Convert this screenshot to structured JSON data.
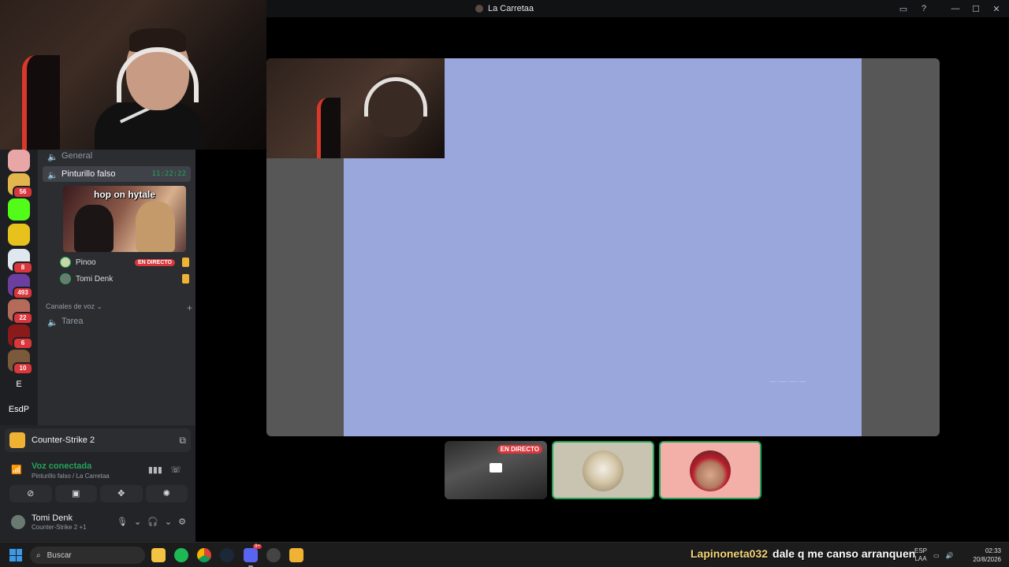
{
  "window": {
    "title": "La Carretaa"
  },
  "servers": [
    {
      "color": "#e8a6a6"
    },
    {
      "color": "#e2b64c",
      "badge": "56"
    },
    {
      "color": "#53fc18"
    },
    {
      "color": "#e8c21c"
    },
    {
      "color": "#dfe7ef",
      "badge": "8"
    },
    {
      "color": "#6b3fa0",
      "badge": "493"
    },
    {
      "color": "#b56b5a",
      "badge": "22"
    },
    {
      "color": "#8b1a1a",
      "badge": "6"
    },
    {
      "color": "#7a5a3a",
      "badge": "10"
    }
  ],
  "server_text": [
    "E",
    "EsdP"
  ],
  "channels": {
    "general": "General",
    "active": {
      "name": "Pinturillo falso",
      "time": "11:22:22"
    },
    "stream_preview_text": "hop on hytale",
    "members": [
      {
        "name": "Pinoo",
        "live": "EN DIRECTO"
      },
      {
        "name": "Tomi Denk"
      }
    ],
    "voice_section": "Canales de voz",
    "tarea": "Tarea"
  },
  "activity": {
    "game": "Counter-Strike 2"
  },
  "voice": {
    "status": "Voz conectada",
    "location": "Pinturillo falso / La Carretaa"
  },
  "user": {
    "name": "Tomi Denk",
    "game": "Counter-Strike 2 +1"
  },
  "stage": {
    "watermark": "—·—·—·—"
  },
  "tiles": {
    "live": "EN DIRECTO"
  },
  "taskbar": {
    "search": "Buscar",
    "chat_user": "Lapinoneta032",
    "chat_msg": "dale q me canso arranquen",
    "lang_top": "ESP",
    "lang_bottom": "LAA",
    "time": "02:33",
    "date": "20/8/2026",
    "discord_badge": "9+"
  },
  "icons": [
    "minimize-icon",
    "maximize-icon",
    "close-icon",
    "inbox-icon",
    "help-icon",
    "speaker-icon",
    "signal-icon",
    "waveform-icon",
    "hangup-icon",
    "camera-off-icon",
    "screen-share-icon",
    "activities-icon",
    "soundboard-icon",
    "mic-icon",
    "headphones-icon",
    "settings-icon",
    "windows-start-icon",
    "search-icon",
    "file-explorer-icon",
    "spotify-icon",
    "chrome-icon",
    "steam-icon",
    "discord-icon",
    "obs-icon",
    "cs2-icon"
  ]
}
